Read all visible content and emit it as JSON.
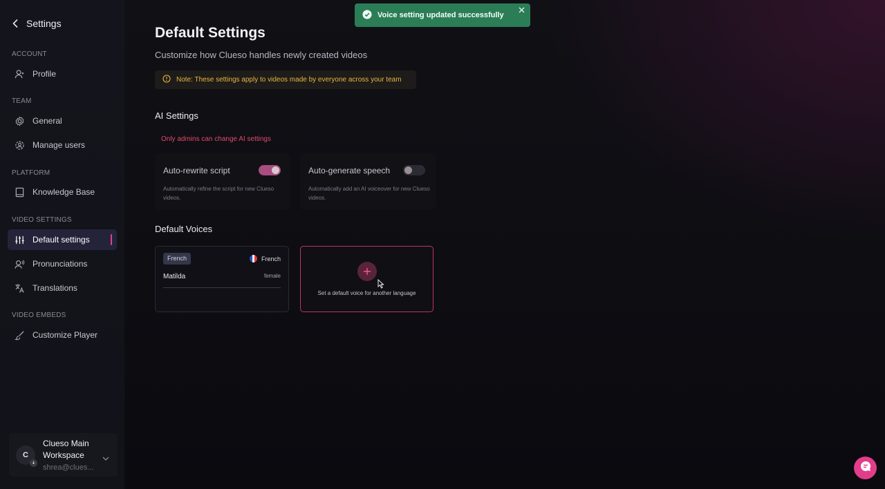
{
  "sidebar": {
    "header": {
      "title": "Settings"
    },
    "sections": [
      {
        "label": "ACCOUNT"
      },
      {
        "label": "TEAM"
      },
      {
        "label": "PLATFORM"
      },
      {
        "label": "VIDEO SETTINGS"
      },
      {
        "label": "VIDEO EMBEDS"
      }
    ],
    "items": {
      "profile": "Profile",
      "general": "General",
      "manage_users": "Manage users",
      "knowledge_base": "Knowledge Base",
      "default_settings": "Default settings",
      "pronunciations": "Pronunciations",
      "translations": "Translations",
      "customize_player": "Customize Player"
    },
    "active_item": "default_settings",
    "workspace": {
      "avatar_initial": "C",
      "name": "Clueso Main Workspace",
      "email": "shrea@clues..."
    }
  },
  "main": {
    "title": "Default Settings",
    "subtitle": "Customize how Clueso handles newly created videos",
    "note": "Note: These settings apply to videos made by everyone across your team",
    "ai_settings": {
      "title": "AI Settings",
      "admin_notice": "Only admins can change AI settings",
      "options": [
        {
          "label": "Auto-rewrite script",
          "description": "Automatically refine the script for new Clueso videos.",
          "enabled": true
        },
        {
          "label": "Auto-generate speech",
          "description": "Automatically add an AI voiceover for new Clueso videos.",
          "enabled": false
        }
      ]
    },
    "default_voices": {
      "title": "Default Voices",
      "voices": [
        {
          "language_chip": "French",
          "language": "French",
          "name": "Matilda",
          "gender": "female"
        }
      ],
      "add_label": "Set a default voice for another language"
    }
  },
  "toast": {
    "message": "Voice setting updated successfully",
    "color": "#2b7d56"
  },
  "colors": {
    "accent": "#e0418f",
    "warning": "#e7b740",
    "danger": "#e24a6c"
  }
}
